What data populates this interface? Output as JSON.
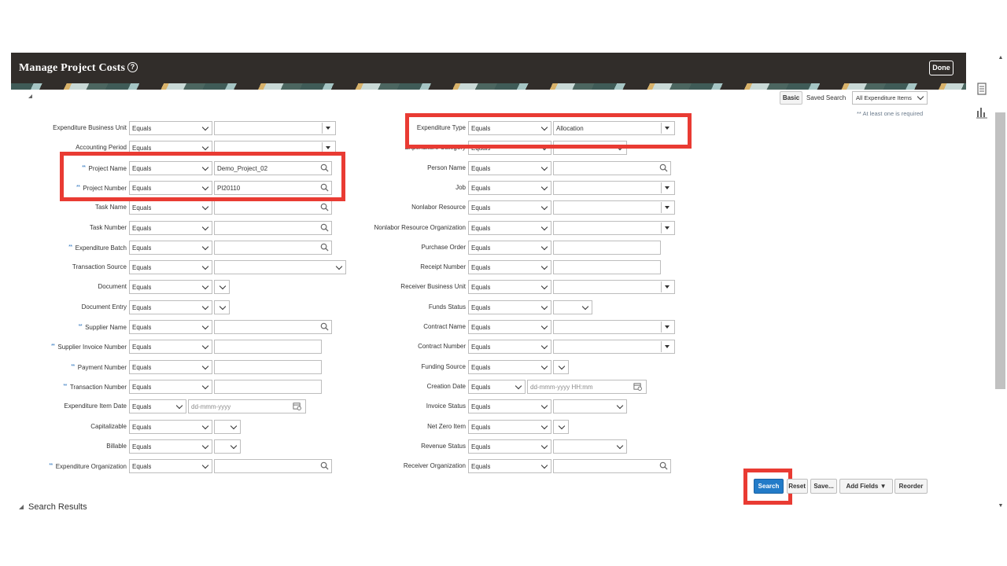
{
  "header": {
    "title": "Manage Project Costs",
    "help_label": "?",
    "done_label": "Done"
  },
  "search_panel": {
    "basic_label": "Basic",
    "saved_search_label": "Saved Search",
    "saved_search_value": "All Expenditure Items",
    "required_note": "** At least one is required",
    "required_mark": "**"
  },
  "fields_left": [
    {
      "label": "Expenditure Business Unit",
      "required": false,
      "operator": "Equals",
      "kind": "select",
      "value": "",
      "placeholder": ""
    },
    {
      "label": "Accounting Period",
      "required": false,
      "operator": "Equals",
      "kind": "select",
      "value": "",
      "placeholder": ""
    },
    {
      "label": "Project Name",
      "required": true,
      "operator": "Equals",
      "kind": "lookup",
      "value": "Demo_Project_02",
      "placeholder": ""
    },
    {
      "label": "Project Number",
      "required": true,
      "operator": "Equals",
      "kind": "lookup",
      "value": "PI20110",
      "placeholder": ""
    },
    {
      "label": "Task Name",
      "required": false,
      "operator": "Equals",
      "kind": "lookup",
      "value": "",
      "placeholder": ""
    },
    {
      "label": "Task Number",
      "required": false,
      "operator": "Equals",
      "kind": "lookup",
      "value": "",
      "placeholder": ""
    },
    {
      "label": "Expenditure Batch",
      "required": true,
      "operator": "Equals",
      "kind": "lookup",
      "value": "",
      "placeholder": ""
    },
    {
      "label": "Transaction Source",
      "required": false,
      "operator": "Equals",
      "kind": "choice-wide",
      "value": "",
      "placeholder": ""
    },
    {
      "label": "Document",
      "required": false,
      "operator": "Equals",
      "kind": "mini",
      "value": "",
      "placeholder": ""
    },
    {
      "label": "Document Entry",
      "required": false,
      "operator": "Equals",
      "kind": "mini",
      "value": "",
      "placeholder": ""
    },
    {
      "label": "Supplier Name",
      "required": true,
      "operator": "Equals",
      "kind": "lookup",
      "value": "",
      "placeholder": ""
    },
    {
      "label": "Supplier Invoice Number",
      "required": true,
      "operator": "Equals",
      "kind": "text",
      "value": "",
      "placeholder": ""
    },
    {
      "label": "Payment Number",
      "required": true,
      "operator": "Equals",
      "kind": "text",
      "value": "",
      "placeholder": ""
    },
    {
      "label": "Transaction Number",
      "required": true,
      "operator": "Equals",
      "kind": "text",
      "value": "",
      "placeholder": ""
    },
    {
      "label": "Expenditure Item Date",
      "required": false,
      "operator": "Equals",
      "kind": "date",
      "value": "",
      "placeholder": "dd-mmm-yyyy"
    },
    {
      "label": "Capitalizable",
      "required": false,
      "operator": "Equals",
      "kind": "small",
      "value": "",
      "placeholder": ""
    },
    {
      "label": "Billable",
      "required": false,
      "operator": "Equals",
      "kind": "small",
      "value": "",
      "placeholder": ""
    },
    {
      "label": "Expenditure Organization",
      "required": true,
      "operator": "Equals",
      "kind": "lookup",
      "value": "",
      "placeholder": ""
    }
  ],
  "fields_right": [
    {
      "label": "Expenditure Type",
      "required": false,
      "operator": "Equals",
      "kind": "select",
      "value": "Allocation",
      "placeholder": ""
    },
    {
      "label": "Expenditure Category",
      "required": false,
      "operator": "Equals",
      "kind": "choice",
      "value": "",
      "placeholder": ""
    },
    {
      "label": "Person Name",
      "required": false,
      "operator": "Equals",
      "kind": "lookup",
      "value": "",
      "placeholder": ""
    },
    {
      "label": "Job",
      "required": false,
      "operator": "Equals",
      "kind": "select",
      "value": "",
      "placeholder": ""
    },
    {
      "label": "Nonlabor Resource",
      "required": false,
      "operator": "Equals",
      "kind": "select",
      "value": "",
      "placeholder": ""
    },
    {
      "label": "Nonlabor Resource Organization",
      "required": false,
      "operator": "Equals",
      "kind": "select",
      "value": "",
      "placeholder": ""
    },
    {
      "label": "Purchase Order",
      "required": false,
      "operator": "Equals",
      "kind": "text",
      "value": "",
      "placeholder": ""
    },
    {
      "label": "Receipt Number",
      "required": false,
      "operator": "Equals",
      "kind": "text",
      "value": "",
      "placeholder": ""
    },
    {
      "label": "Receiver Business Unit",
      "required": false,
      "operator": "Equals",
      "kind": "select",
      "value": "",
      "placeholder": ""
    },
    {
      "label": "Funds Status",
      "required": false,
      "operator": "Equals",
      "kind": "medium",
      "value": "",
      "placeholder": ""
    },
    {
      "label": "Contract Name",
      "required": false,
      "operator": "Equals",
      "kind": "select",
      "value": "",
      "placeholder": ""
    },
    {
      "label": "Contract Number",
      "required": false,
      "operator": "Equals",
      "kind": "select",
      "value": "",
      "placeholder": ""
    },
    {
      "label": "Funding Source",
      "required": false,
      "operator": "Equals",
      "kind": "small",
      "value": "",
      "placeholder": ""
    },
    {
      "label": "Creation Date",
      "required": false,
      "operator": "Equals",
      "kind": "datetime",
      "value": "",
      "placeholder": "dd-mmm-yyyy HH:mm"
    },
    {
      "label": "Invoice Status",
      "required": false,
      "operator": "Equals",
      "kind": "choice",
      "value": "",
      "placeholder": ""
    },
    {
      "label": "Net Zero Item",
      "required": false,
      "operator": "Equals",
      "kind": "small",
      "value": "",
      "placeholder": ""
    },
    {
      "label": "Revenue Status",
      "required": false,
      "operator": "Equals",
      "kind": "choice",
      "value": "",
      "placeholder": ""
    },
    {
      "label": "Receiver Organization",
      "required": false,
      "operator": "Equals",
      "kind": "lookup",
      "value": "",
      "placeholder": ""
    }
  ],
  "buttons": {
    "search": "Search",
    "reset": "Reset",
    "save": "Save...",
    "add_fields": "Add Fields",
    "reorder": "Reorder"
  },
  "results": {
    "heading": "Search Results"
  },
  "colors": {
    "accent": "#227bc8",
    "highlight": "#e93b33",
    "header_bg": "#312d2a"
  },
  "icons": {
    "help": "help-icon",
    "search": "search-icon",
    "calendar": "calendar-icon",
    "dropdown": "chevron-down-icon",
    "list": "list-icon",
    "chart": "bar-chart-icon"
  }
}
